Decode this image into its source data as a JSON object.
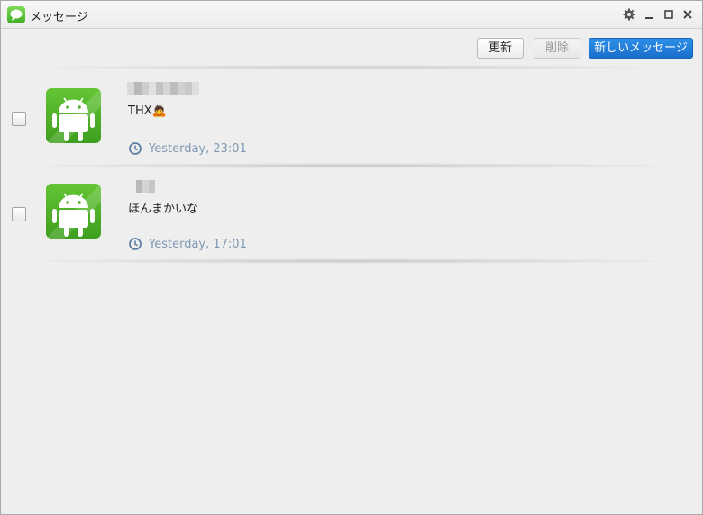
{
  "window": {
    "title": "メッセージ",
    "icons": {
      "app": "speech-bubble-icon",
      "settings": "gear-icon",
      "minimize": "minimize-icon",
      "maximize": "maximize-icon",
      "close": "close-icon"
    }
  },
  "toolbar": {
    "refresh_label": "更新",
    "delete_label": "削除",
    "new_message_label": "新しいメッセージ"
  },
  "messages": [
    {
      "avatar": "android-icon",
      "preview": "THX🙇",
      "time": "Yesterday, 23:01",
      "time_icon": "clock-icon"
    },
    {
      "avatar": "android-icon",
      "preview": "ほんまかいな",
      "time": "Yesterday, 17:01",
      "time_icon": "clock-icon"
    }
  ],
  "colors": {
    "accent": "#1a78d6",
    "timestamp": "#7f98b3",
    "avatar_green": "#4cb02b"
  }
}
